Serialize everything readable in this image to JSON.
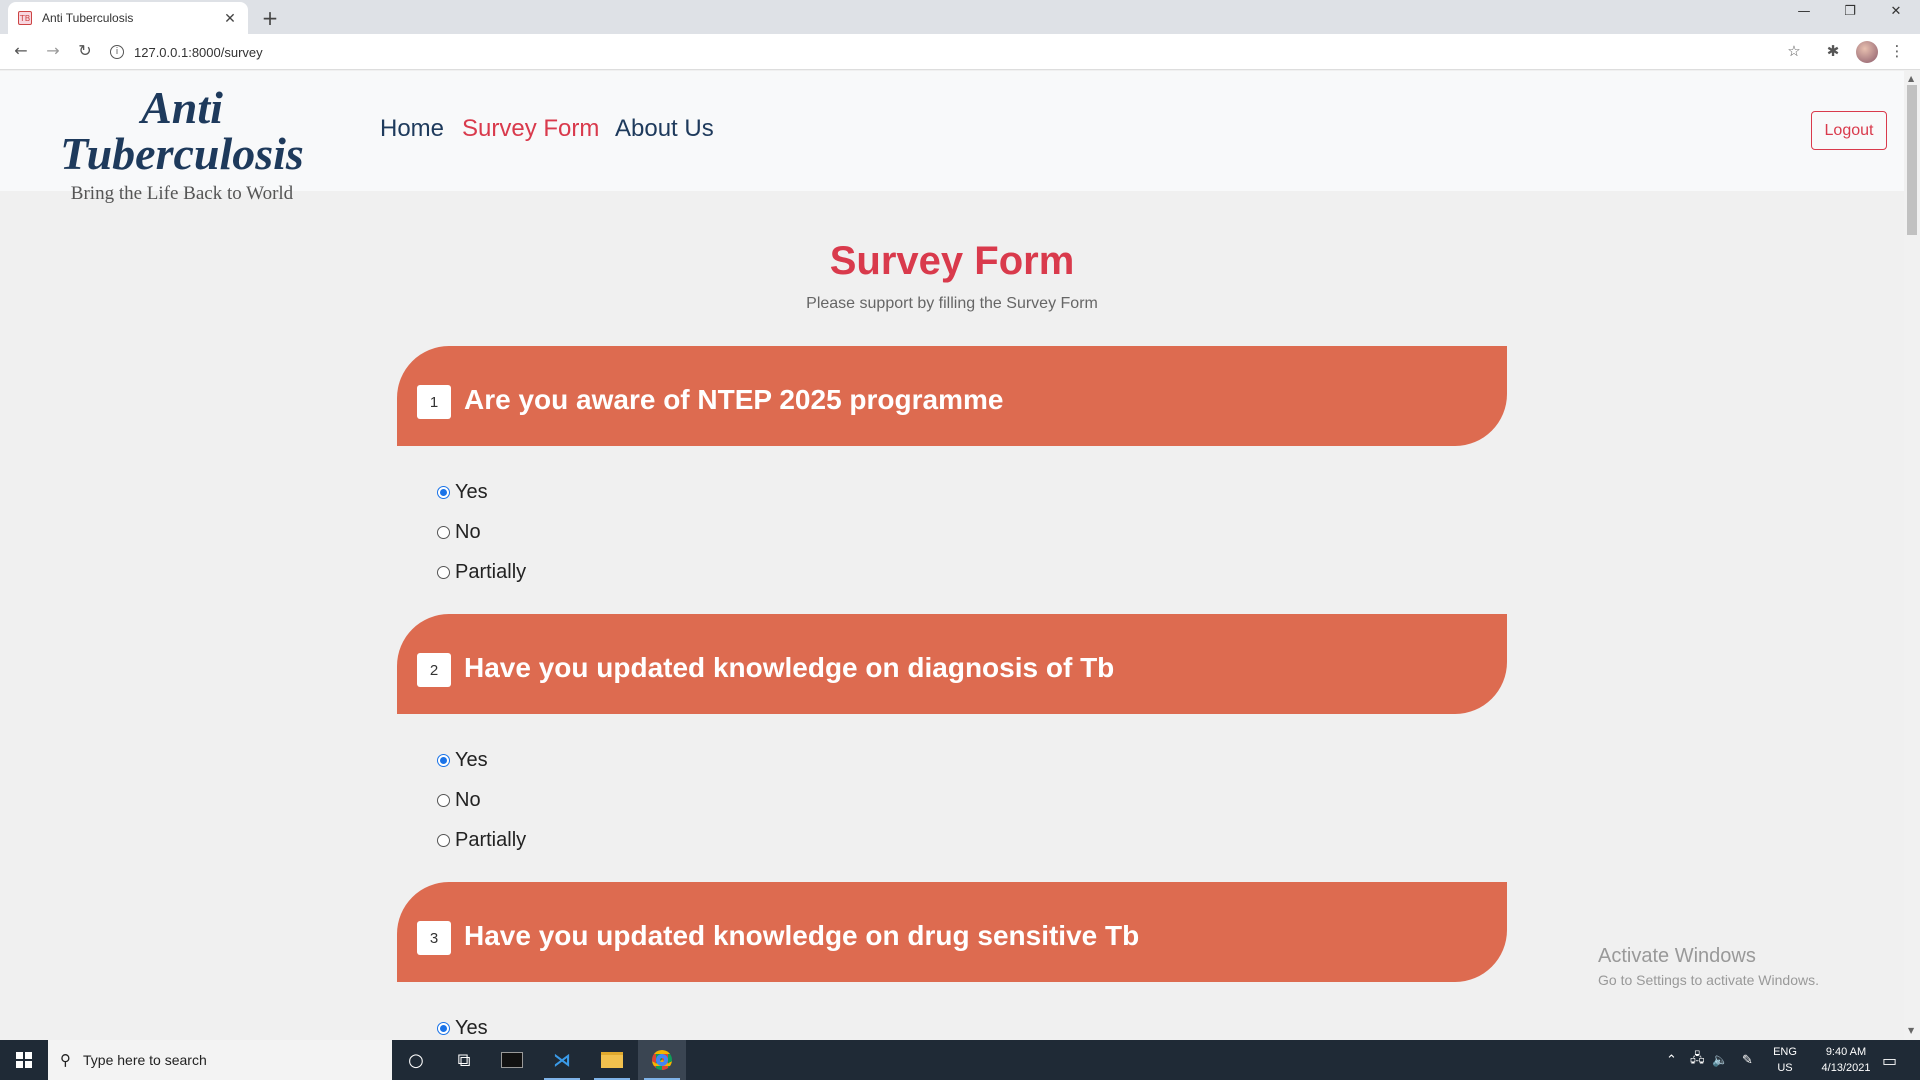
{
  "browser": {
    "tab_title": "Anti Tuberculosis",
    "favicon_text": "TB",
    "url": "127.0.0.1:8000/survey"
  },
  "site": {
    "brand_name": "Anti Tuberculosis",
    "tagline": "Bring the Life Back to World",
    "nav": [
      {
        "label": "Home",
        "active": false
      },
      {
        "label": "Survey Form",
        "active": true
      },
      {
        "label": "About Us",
        "active": false
      }
    ],
    "logout_label": "Logout"
  },
  "survey": {
    "title": "Survey Form",
    "subtitle": "Please support by filling the Survey Form",
    "questions": [
      {
        "number": "1",
        "text": "Are you aware of NTEP 2025 programme",
        "options": [
          {
            "label": "Yes",
            "checked": true
          },
          {
            "label": "No",
            "checked": false
          },
          {
            "label": "Partially",
            "checked": false
          }
        ]
      },
      {
        "number": "2",
        "text": "Have you updated knowledge on diagnosis of Tb",
        "options": [
          {
            "label": "Yes",
            "checked": true
          },
          {
            "label": "No",
            "checked": false
          },
          {
            "label": "Partially",
            "checked": false
          }
        ]
      },
      {
        "number": "3",
        "text": "Have you updated knowledge on drug sensitive Tb",
        "options": [
          {
            "label": "Yes",
            "checked": true
          }
        ]
      }
    ]
  },
  "watermark": {
    "line1": "Activate Windows",
    "line2": "Go to Settings to activate Windows."
  },
  "taskbar": {
    "search_placeholder": "Type here to search",
    "lang_line1": "ENG",
    "lang_line2": "US",
    "time": "9:40 AM",
    "date": "4/13/2021"
  },
  "colors": {
    "accent": "#d93a4c",
    "navy": "#1e3a5c",
    "question_banner": "#dd6b50"
  }
}
